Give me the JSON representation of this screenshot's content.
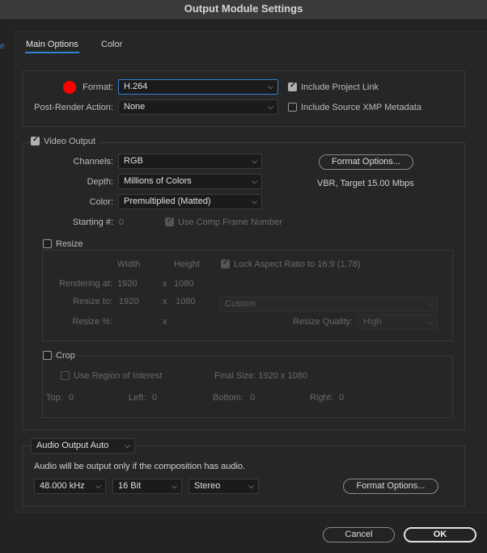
{
  "window": {
    "title": "Output Module Settings"
  },
  "tabs": [
    {
      "label": "Main Options"
    },
    {
      "label": "Color"
    }
  ],
  "format": {
    "label": "Format:",
    "value": "H.264",
    "post_render_label": "Post-Render Action:",
    "post_render_value": "None",
    "include_project_link": "Include Project Link",
    "include_xmp": "Include Source XMP Metadata"
  },
  "video": {
    "section_label": "Video Output",
    "channels_label": "Channels:",
    "channels_value": "RGB",
    "depth_label": "Depth:",
    "depth_value": "Millions of Colors",
    "color_label": "Color:",
    "color_value": "Premultiplied (Matted)",
    "starting_label": "Starting #:",
    "starting_value": "0",
    "use_comp_frame": "Use Comp Frame Number",
    "format_options": "Format Options...",
    "bitrate_info": "VBR, Target 15.00 Mbps"
  },
  "resize": {
    "label": "Resize",
    "width_header": "Width",
    "height_header": "Height",
    "lock_aspect": "Lock Aspect Ratio to 16:9 (1.78)",
    "rendering_label": "Rendering at:",
    "rendering_w": "1920",
    "rendering_h": "1080",
    "resize_to_label": "Resize to:",
    "resize_w": "1920",
    "resize_h": "1080",
    "preset_value": "Custom",
    "percent_label": "Resize %:",
    "x": "x",
    "quality_label": "Resize Quality:",
    "quality_value": "High"
  },
  "crop": {
    "label": "Crop",
    "use_roi": "Use Region of Interest",
    "final_size": "Final Size: 1920 x 1080",
    "top_label": "Top:",
    "top_value": "0",
    "left_label": "Left:",
    "left_value": "0",
    "bottom_label": "Bottom:",
    "bottom_value": "0",
    "right_label": "Right:",
    "right_value": "0"
  },
  "audio": {
    "mode_value": "Audio Output Auto",
    "info": "Audio will be output only if the composition has audio.",
    "rate_value": "48.000 kHz",
    "bits_value": "16 Bit",
    "channels_value": "Stereo",
    "format_options": "Format Options..."
  },
  "footer": {
    "cancel": "Cancel",
    "ok": "OK"
  },
  "colors": {
    "accent": "#2f83d6",
    "marker": "#ff0000",
    "background": "#232323"
  }
}
